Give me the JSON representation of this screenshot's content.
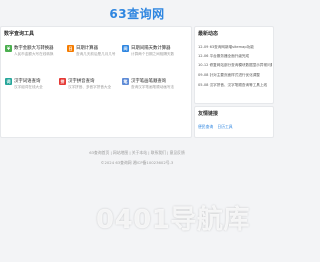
{
  "site": {
    "title": "63查询网"
  },
  "tools_panel": {
    "heading": "数字查询工具",
    "items": [
      {
        "name": "数字金额大写转换器",
        "desc": "人民币金额大写在线转换",
        "icon": "yuan-icon",
        "color": "#4caf50"
      },
      {
        "name": "日期计算器",
        "desc": "查询几天前后是几月几号",
        "icon": "calendar-icon",
        "color": "#f57c00"
      },
      {
        "name": "日期间隔天数计算器",
        "desc": "计算两个日期之间相隔天数",
        "icon": "calendar-range-icon",
        "color": "#2f86e0"
      },
      {
        "name": "汉字词语查询",
        "desc": "汉字组词在线大全",
        "icon": "book-icon",
        "color": "#26a69a"
      },
      {
        "name": "汉字拼音查询",
        "desc": "汉字拼音、多音字拼音大全",
        "icon": "pinyin-icon",
        "color": "#e53935"
      },
      {
        "name": "汉字笔画笔顺查询",
        "desc": "查询汉字笔画笔顺动画写法",
        "icon": "brush-icon",
        "color": "#5e8bd6"
      }
    ]
  },
  "news_panel": {
    "heading": "最新动态",
    "items": [
      "12-09 63查询网新增sitemap功能",
      "12-06 平台服务器全面升级完成",
      "10-12 修复网站部分查询模块数据显示异常问题",
      "09-08 针对主要页面样式进行优化调整",
      "05-08 汉字拼音、汉字笔顺查询等工具上线"
    ]
  },
  "links_panel": {
    "heading": "友情链接",
    "items": [
      "便民查询",
      "日历工具"
    ]
  },
  "footer": {
    "links": "63查询首页 | 网站地图 | 关于本站 | 联系我们 | 意见反馈",
    "copyright": "©2024 63查询网 湘ICP备10023602号-3"
  },
  "watermark": {
    "text": "0401导航库"
  }
}
